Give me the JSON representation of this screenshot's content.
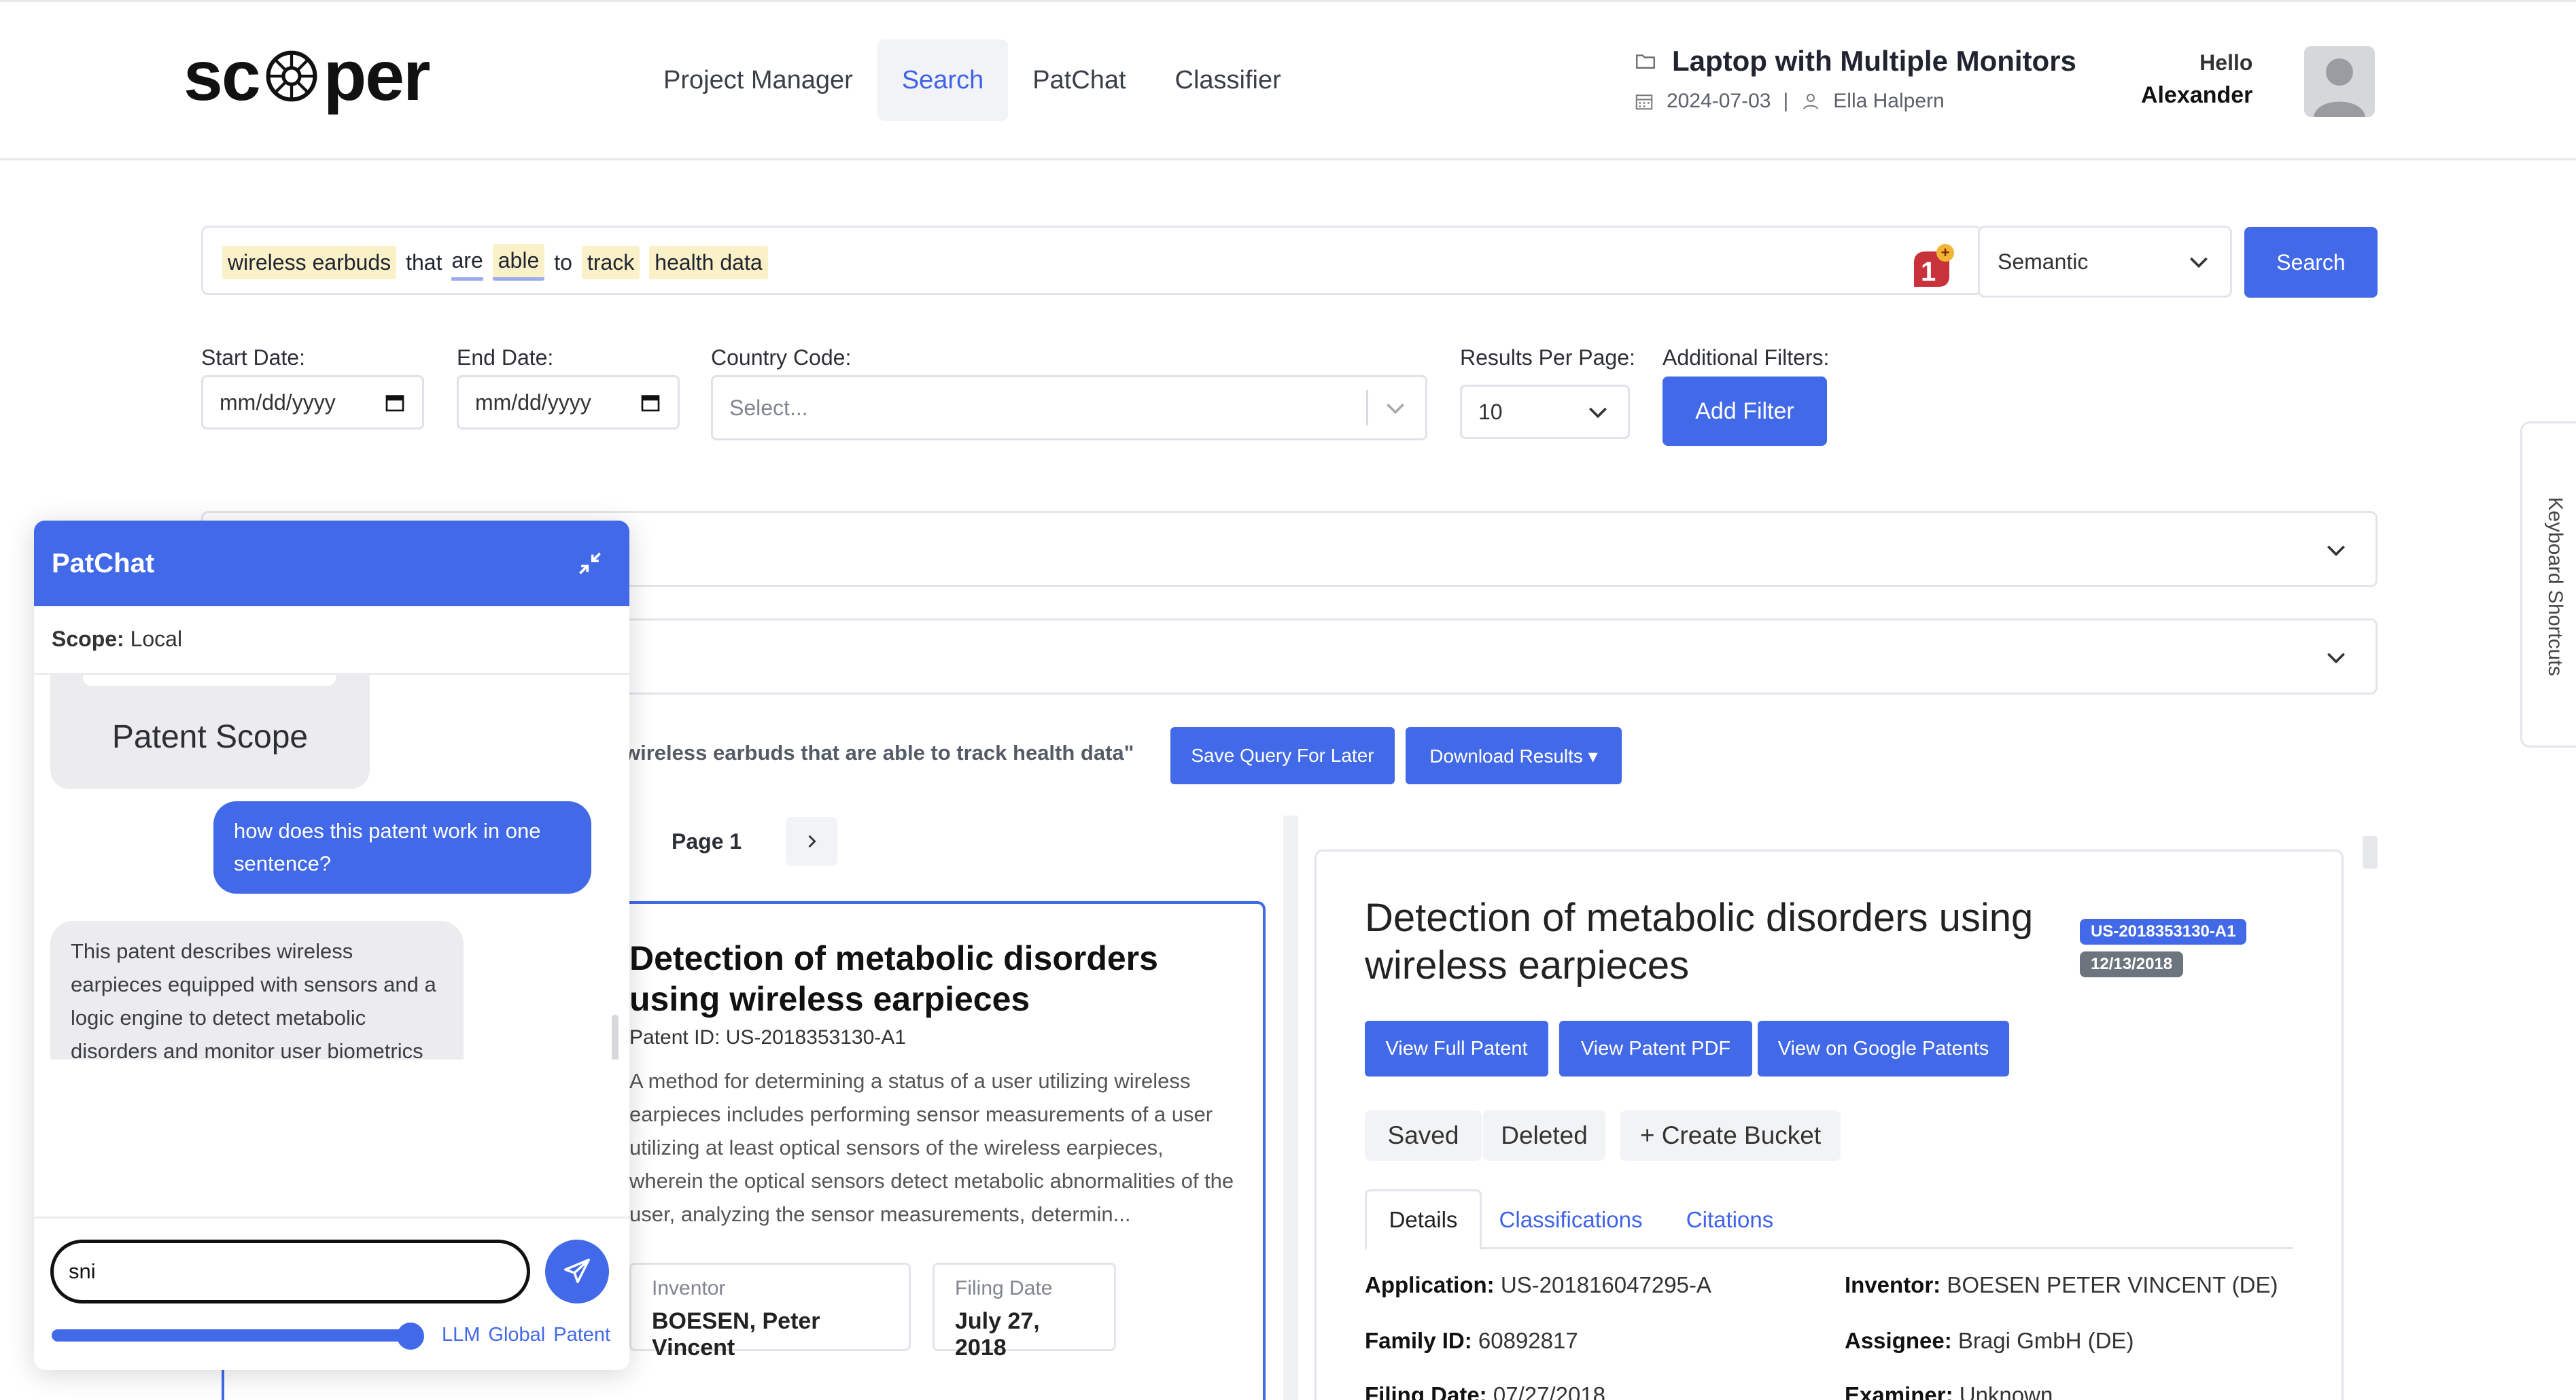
{
  "brand": {
    "logo_left": "sc",
    "logo_right": "per"
  },
  "nav": {
    "items": [
      "Project Manager",
      "Search",
      "PatChat",
      "Classifier"
    ],
    "active": "Search"
  },
  "project": {
    "title": "Laptop with Multiple Monitors",
    "date": "2024-07-03",
    "separator": "|",
    "owner": "Ella Halpern"
  },
  "user": {
    "greeting": "Hello",
    "name": "Alexander"
  },
  "search": {
    "tokens": [
      {
        "text": "wireless earbuds",
        "style": "highlight"
      },
      {
        "text": "that",
        "style": "plain"
      },
      {
        "text": "are",
        "style": "underline"
      },
      {
        "text": "able",
        "style": "highlight-underline"
      },
      {
        "text": "to",
        "style": "plain"
      },
      {
        "text": "track",
        "style": "highlight"
      },
      {
        "text": "health data",
        "style": "highlight"
      }
    ],
    "badge_count": "1",
    "mode": "Semantic",
    "button": "Search"
  },
  "filters": {
    "start_label": "Start Date:",
    "start_placeholder": "mm/dd/yyyy",
    "end_label": "End Date:",
    "end_placeholder": "mm/dd/yyyy",
    "country_label": "Country Code:",
    "country_placeholder": "Select...",
    "rpp_label": "Results Per Page:",
    "rpp_value": "10",
    "additional_label": "Additional Filters:",
    "add_button": "Add Filter"
  },
  "results_toolbar": {
    "query_text": "wireless earbuds that are able to track health data\"",
    "save_button": "Save Query For Later",
    "download_button": "Download Results ▾"
  },
  "paging": {
    "label": "Page 1"
  },
  "result_card": {
    "title": "Detection of metabolic disorders using wireless earpieces",
    "patent_id": "Patent ID: US-2018353130-A1",
    "abstract": "A method for determining a status of a user utilizing wireless earpieces includes performing sensor measurements of a user utilizing at least optical sensors of the wireless earpieces, wherein the optical sensors detect metabolic abnormalities of the user, analyzing the sensor measurements, determin...",
    "inventor_label": "Inventor",
    "inventor_value": "BOESEN, Peter Vincent",
    "filing_label": "Filing Date",
    "filing_value": "July 27, 2018"
  },
  "detail": {
    "title": "Detection of metabolic disorders using wireless earpieces",
    "id_pill": "US-2018353130-A1",
    "date_pill": "12/13/2018",
    "buttons": [
      "View Full Patent",
      "View Patent PDF",
      "View on Google Patents"
    ],
    "chips": [
      "Saved",
      "Deleted",
      "+ Create Bucket"
    ],
    "tabs": [
      "Details",
      "Classifications",
      "Citations"
    ],
    "fields": {
      "application_k": "Application:",
      "application_v": "US-201816047295-A",
      "inventor_k": "Inventor:",
      "inventor_v": "BOESEN PETER VINCENT (DE)",
      "family_k": "Family ID:",
      "family_v": "60892817",
      "assignee_k": "Assignee:",
      "assignee_v": "Bragi GmbH (DE)",
      "filing_k": "Filing Date:",
      "filing_v": "07/27/2018",
      "examiner_k": "Examiner:",
      "examiner_v": "Unknown"
    }
  },
  "side_tab": {
    "label": "Keyboard Shortcuts"
  },
  "patchat": {
    "title": "PatChat",
    "scope_label": "Scope:",
    "scope_value": "Local",
    "scope_card": "Patent Scope",
    "user_msg": "how does this patent work in one sentence?",
    "bot_msg": "This patent describes wireless earpieces equipped with sensors and a logic engine to detect metabolic disorders and monitor user biometrics by analyzing physiological data such as pulse rate, oxygen saturation, and blood pressure.",
    "input_value": "sni",
    "modes": [
      "LLM",
      "Global",
      "Patent"
    ]
  },
  "colors": {
    "accent": "#4169e8",
    "highlight": "#fbf1c9",
    "badge": "#c8323b",
    "badge_plus": "#f2b533"
  }
}
